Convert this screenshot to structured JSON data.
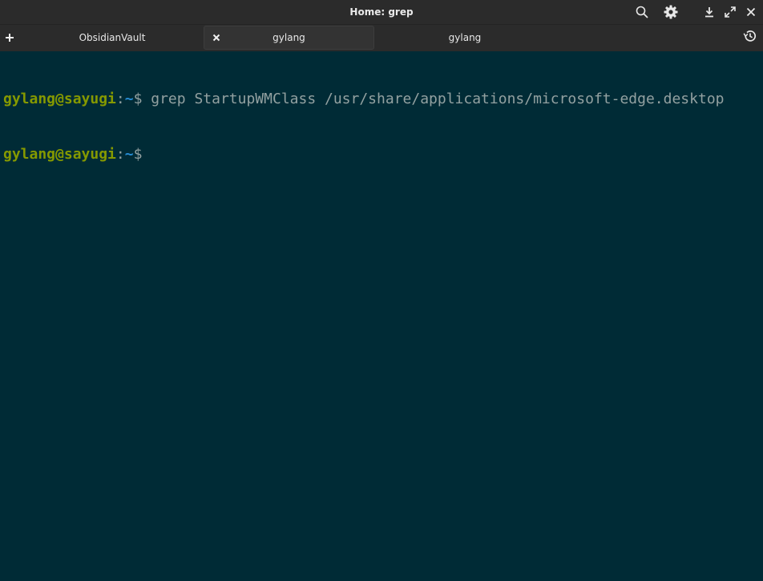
{
  "window": {
    "title": "Home: grep"
  },
  "title_actions": {
    "icons": [
      "search-icon",
      "gear-icon",
      "download-icon",
      "maximize-icon",
      "close-icon"
    ]
  },
  "tabs": [
    {
      "label": "ObsidianVault",
      "active": false
    },
    {
      "label": "gylang",
      "active": true
    },
    {
      "label": "gylang",
      "active": false
    }
  ],
  "terminal": {
    "lines": [
      {
        "user_host": "gylang@sayugi",
        "colon": ":",
        "path": "~",
        "dollar": "$",
        "command": " grep StartupWMClass /usr/share/applications/microsoft-edge.desktop"
      },
      {
        "user_host": "gylang@sayugi",
        "colon": ":",
        "path": "~",
        "dollar": "$",
        "command": ""
      }
    ]
  },
  "colors": {
    "terminal_bg": "#002b36",
    "user_host": "#859900",
    "path": "#268bd2",
    "text": "#93a1a1",
    "chrome_bg": "#2b2b2b"
  }
}
